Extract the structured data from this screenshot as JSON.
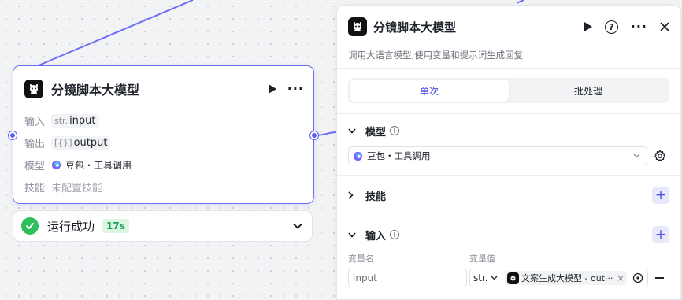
{
  "canvas": {
    "node": {
      "title": "分镜脚本大模型",
      "rows": [
        {
          "label": "输入",
          "prefix": "str.",
          "value": "input"
        },
        {
          "label": "输出",
          "prefix": "[{}]",
          "value": "output"
        },
        {
          "label": "模型",
          "value": "豆包・工具调用"
        },
        {
          "label": "技能",
          "value": "未配置技能"
        }
      ]
    },
    "run_status": {
      "text": "运行成功",
      "duration": "17s",
      "state": "success"
    }
  },
  "panel": {
    "title": "分镜脚本大模型",
    "description": "调用大语言模型,使用变量和提示词生成回复",
    "tabs": [
      {
        "label": "单次",
        "active": true
      },
      {
        "label": "批处理",
        "active": false
      }
    ],
    "model_section": {
      "title": "模型",
      "selected": "豆包・工具调用"
    },
    "skills_section": {
      "title": "技能"
    },
    "input_section": {
      "title": "输入",
      "col_name": "变量名",
      "col_value": "变量值",
      "variable": {
        "name": "input",
        "type": "str.",
        "ref_text": "文案生成大模型 - out···"
      }
    }
  },
  "colors": {
    "accent": "#4e52e8",
    "edge": "#6b6ef5",
    "success": "#2ebf5b"
  },
  "icons": [
    "robot-logo-icon",
    "play-icon",
    "more-icon",
    "help-icon",
    "close-icon",
    "chevron-down-icon",
    "info-icon",
    "plus-icon",
    "gear-icon",
    "check-circle-icon",
    "target-icon",
    "minus-icon",
    "doubao-icon"
  ]
}
